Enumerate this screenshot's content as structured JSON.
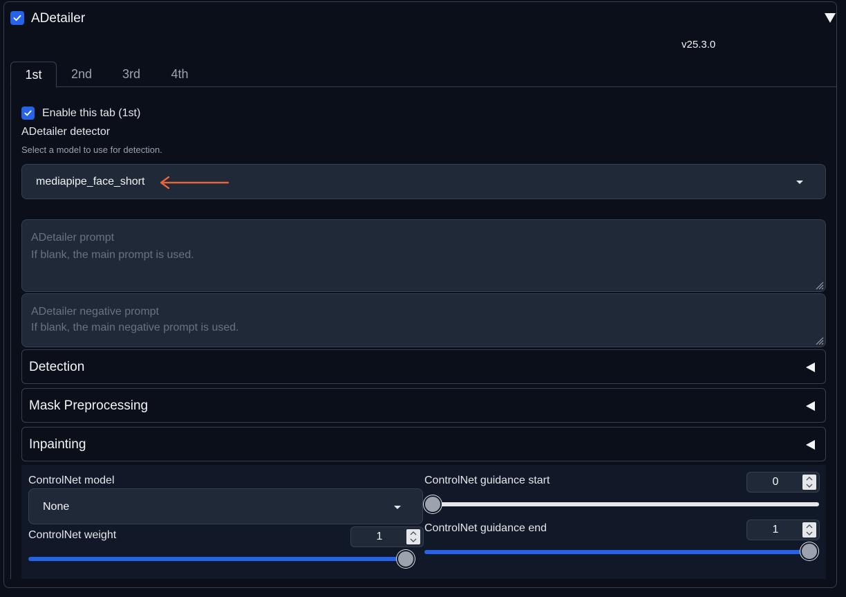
{
  "header": {
    "title": "ADetailer",
    "checked": true,
    "version": "v25.3.0"
  },
  "tabs": [
    {
      "label": "1st",
      "active": true
    },
    {
      "label": "2nd",
      "active": false
    },
    {
      "label": "3rd",
      "active": false
    },
    {
      "label": "4th",
      "active": false
    }
  ],
  "enable_tab": {
    "label": "Enable this tab (1st)",
    "checked": true
  },
  "detector": {
    "label": "ADetailer detector",
    "info": "Select a model to use for detection.",
    "value": "mediapipe_face_short"
  },
  "prompt": {
    "placeholder_title": "ADetailer prompt",
    "placeholder_hint": "If blank, the main prompt is used."
  },
  "negative_prompt": {
    "placeholder_title": "ADetailer negative prompt",
    "placeholder_hint": "If blank, the main negative prompt is used."
  },
  "accordions": [
    {
      "title": "Detection"
    },
    {
      "title": "Mask Preprocessing"
    },
    {
      "title": "Inpainting"
    }
  ],
  "controlnet": {
    "model": {
      "label": "ControlNet model",
      "value": "None"
    },
    "weight": {
      "label": "ControlNet weight",
      "value": "1",
      "fraction": 1.0
    },
    "guidance_start": {
      "label": "ControlNet guidance start",
      "value": "0",
      "fraction": 0.0
    },
    "guidance_end": {
      "label": "ControlNet guidance end",
      "value": "1",
      "fraction": 1.0
    }
  },
  "colors": {
    "accent": "#2563eb",
    "annotation_arrow": "#e8643a",
    "background": "#0b0f19",
    "input": "#1f2937"
  },
  "icons": {
    "check": "check-icon",
    "collapse": "triangle-down-icon",
    "dropdown": "caret-down-icon",
    "accordion": "triangle-left-icon",
    "annotation": "arrow-left-icon"
  }
}
